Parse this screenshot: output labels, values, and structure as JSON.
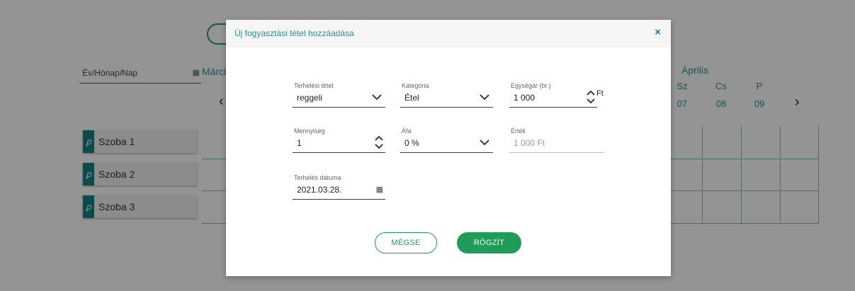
{
  "background": {
    "date_placeholder": "Év/Hónap/Nap",
    "month_left": "Márci",
    "month_right": "Április",
    "days": [
      {
        "name": "Sz",
        "date": "07"
      },
      {
        "name": "Cs",
        "date": "08"
      },
      {
        "name": "P",
        "date": "09"
      }
    ],
    "rooms": [
      "Szoba 1",
      "Szoba 2",
      "Szoba 3"
    ]
  },
  "modal": {
    "title": "Új fogyasztási tétel hozzáadása",
    "close_symbol": "×",
    "fields": {
      "charge_item": {
        "label": "Terhelési tétel",
        "value": "reggeli"
      },
      "category": {
        "label": "Kategória",
        "value": "Étel"
      },
      "unit_price": {
        "label": "Egységár (br.)",
        "value": "1 000",
        "unit": "Ft"
      },
      "quantity": {
        "label": "Mennyiség",
        "value": "1"
      },
      "vat": {
        "label": "Áfa",
        "value": "0 %"
      },
      "total": {
        "label": "Érték",
        "value": "1 000 Ft"
      },
      "charge_date": {
        "label": "Terhelés dátuma",
        "value": "2021.03.28."
      }
    },
    "buttons": {
      "cancel": "MÉGSE",
      "save": "RÖGZÍT"
    }
  },
  "icons": {
    "calendar": "calendar-icon",
    "chevron_down": "chevron-down-icon",
    "spinner": "up-down-spinner-icon",
    "key": "key-icon",
    "close": "close-icon"
  },
  "colors": {
    "accent_teal": "#2a8f94",
    "primary_green": "#1f9c57",
    "close_blue": "#1f6fb5"
  }
}
